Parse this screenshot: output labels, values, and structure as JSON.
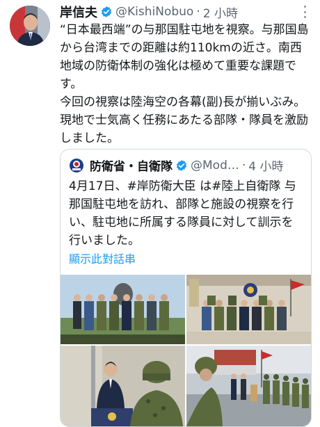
{
  "author": {
    "name": "岸信夫",
    "handle": "@KishiNobuo",
    "separator": "·",
    "time": "2 小時",
    "verified_color": "#1d9bf0"
  },
  "tweet": {
    "text": "“日本最西端”の与那国駐屯地を視察。与那国島から台湾までの距離は約110kmの近さ。南西地域の防衛体制の強化は極めて重要な課題です。\n今回の視察は陸海空の各幕(副)長が揃いぶみ。現地で士気高く任務にあたる部隊・隊員を激励しました。"
  },
  "quoted": {
    "name": "防衛省・自衛隊",
    "handle": "@Mod…",
    "separator": "·",
    "time": "4 小時",
    "text": "4月17日、#岸防衛大臣 は#陸上自衛隊 与那国駐屯地を訪れ、部隊と施設の視察を行い、駐屯地に所属する隊員に対して訓示を行いました。",
    "show_thread": "顯示此對話串",
    "link_color": "#1d9bf0"
  },
  "icons": {
    "avatar": "avatar",
    "verified": "verified-badge-icon",
    "more": "more-options-icon",
    "ministry_logo": "ministry-logo"
  }
}
